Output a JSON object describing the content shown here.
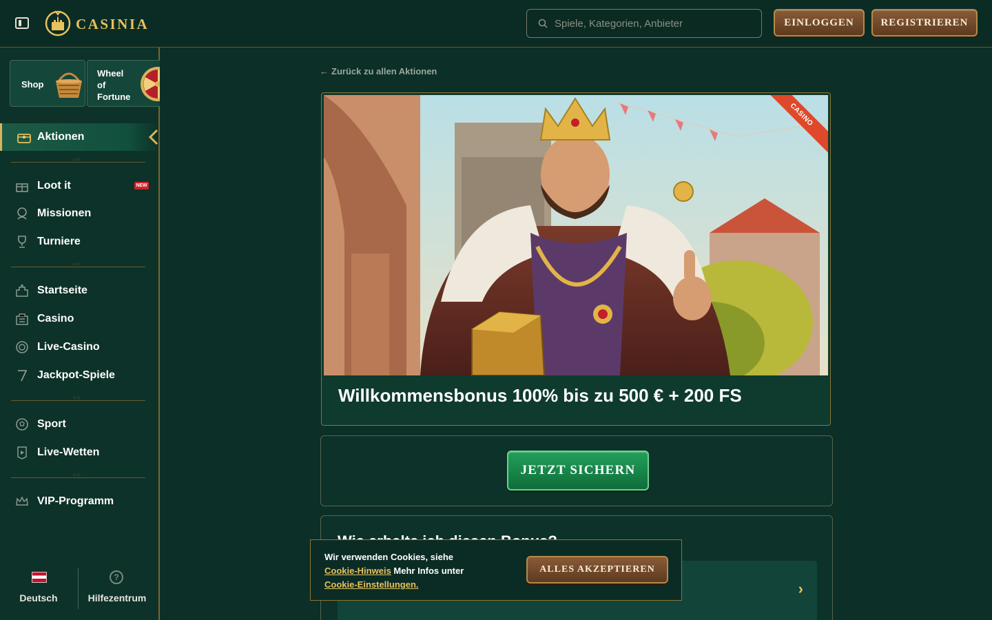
{
  "header": {
    "logo_text": "CASINIA",
    "search_placeholder": "Spiele, Kategorien, Anbieter",
    "login_label": "EINLOGGEN",
    "register_label": "REGISTRIEREN"
  },
  "sidebar": {
    "tiles": [
      {
        "label": "Shop",
        "icon": "basket-icon"
      },
      {
        "label": "Wheel of Fortune",
        "icon": "wheel-icon"
      }
    ],
    "active_item": {
      "label": "Aktionen",
      "icon": "treasure-chest-icon"
    },
    "group1": [
      {
        "label": "Loot it",
        "icon": "gift-icon",
        "badge": "NEW"
      },
      {
        "label": "Missionen",
        "icon": "mission-icon"
      },
      {
        "label": "Turniere",
        "icon": "trophy-icon"
      }
    ],
    "group2": [
      {
        "label": "Startseite",
        "icon": "home-icon"
      },
      {
        "label": "Casino",
        "icon": "casino-icon"
      },
      {
        "label": "Live-Casino",
        "icon": "live-casino-icon"
      },
      {
        "label": "Jackpot-Spiele",
        "icon": "jackpot-icon"
      }
    ],
    "group3": [
      {
        "label": "Sport",
        "icon": "football-icon"
      },
      {
        "label": "Live-Wetten",
        "icon": "live-bet-icon"
      }
    ],
    "group4": [
      {
        "label": "VIP-Programm",
        "icon": "crown-icon"
      }
    ],
    "bottom": {
      "language_label": "Deutsch",
      "help_label": "Hilfezentrum"
    }
  },
  "main": {
    "back_link": "Zurück zu allen Aktionen",
    "promo": {
      "ribbon": "CASINO",
      "title": "Willkommensbonus 100% bis zu 500 € + 200 FS"
    },
    "cta_label": "JETZT SICHERN",
    "faq_heading": "Wie erhalte ich diesen Bonus?"
  },
  "cookie": {
    "text_1": "Wir verwenden Cookies, siehe",
    "link_1": "Cookie-Hinweis",
    "text_2": "Mehr Infos unter",
    "link_2": "Cookie-Einstellungen.",
    "accept_label": "ALLES AKZEPTIEREN"
  },
  "colors": {
    "background": "#0c2f27",
    "accent_gold": "#e9c15d",
    "button_brown": "#6e4628",
    "button_green": "#1a8a4a",
    "badge_red": "#d3202b"
  }
}
